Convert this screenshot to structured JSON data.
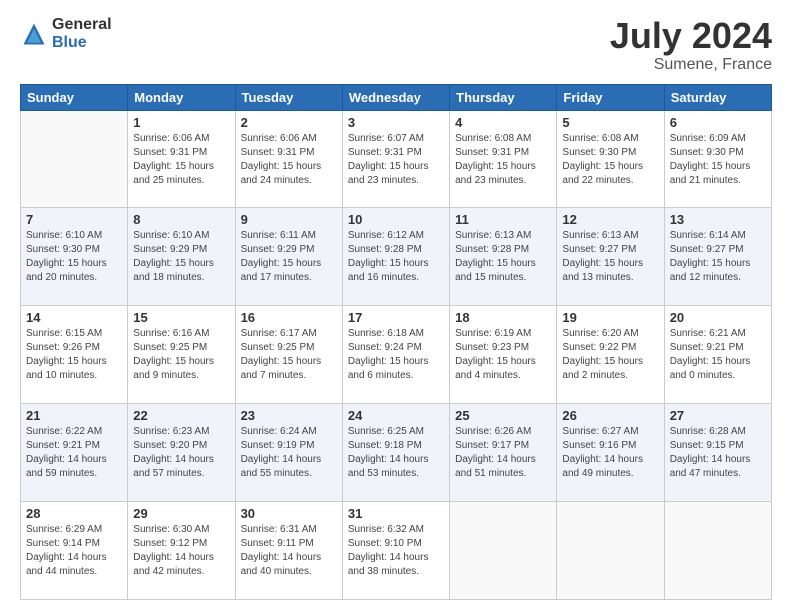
{
  "logo": {
    "general": "General",
    "blue": "Blue"
  },
  "title": "July 2024",
  "subtitle": "Sumene, France",
  "days_of_week": [
    "Sunday",
    "Monday",
    "Tuesday",
    "Wednesday",
    "Thursday",
    "Friday",
    "Saturday"
  ],
  "weeks": [
    [
      {
        "day": "",
        "sunrise": "",
        "sunset": "",
        "daylight": ""
      },
      {
        "day": "1",
        "sunrise": "Sunrise: 6:06 AM",
        "sunset": "Sunset: 9:31 PM",
        "daylight": "Daylight: 15 hours and 25 minutes."
      },
      {
        "day": "2",
        "sunrise": "Sunrise: 6:06 AM",
        "sunset": "Sunset: 9:31 PM",
        "daylight": "Daylight: 15 hours and 24 minutes."
      },
      {
        "day": "3",
        "sunrise": "Sunrise: 6:07 AM",
        "sunset": "Sunset: 9:31 PM",
        "daylight": "Daylight: 15 hours and 23 minutes."
      },
      {
        "day": "4",
        "sunrise": "Sunrise: 6:08 AM",
        "sunset": "Sunset: 9:31 PM",
        "daylight": "Daylight: 15 hours and 23 minutes."
      },
      {
        "day": "5",
        "sunrise": "Sunrise: 6:08 AM",
        "sunset": "Sunset: 9:30 PM",
        "daylight": "Daylight: 15 hours and 22 minutes."
      },
      {
        "day": "6",
        "sunrise": "Sunrise: 6:09 AM",
        "sunset": "Sunset: 9:30 PM",
        "daylight": "Daylight: 15 hours and 21 minutes."
      }
    ],
    [
      {
        "day": "7",
        "sunrise": "Sunrise: 6:10 AM",
        "sunset": "Sunset: 9:30 PM",
        "daylight": "Daylight: 15 hours and 20 minutes."
      },
      {
        "day": "8",
        "sunrise": "Sunrise: 6:10 AM",
        "sunset": "Sunset: 9:29 PM",
        "daylight": "Daylight: 15 hours and 18 minutes."
      },
      {
        "day": "9",
        "sunrise": "Sunrise: 6:11 AM",
        "sunset": "Sunset: 9:29 PM",
        "daylight": "Daylight: 15 hours and 17 minutes."
      },
      {
        "day": "10",
        "sunrise": "Sunrise: 6:12 AM",
        "sunset": "Sunset: 9:28 PM",
        "daylight": "Daylight: 15 hours and 16 minutes."
      },
      {
        "day": "11",
        "sunrise": "Sunrise: 6:13 AM",
        "sunset": "Sunset: 9:28 PM",
        "daylight": "Daylight: 15 hours and 15 minutes."
      },
      {
        "day": "12",
        "sunrise": "Sunrise: 6:13 AM",
        "sunset": "Sunset: 9:27 PM",
        "daylight": "Daylight: 15 hours and 13 minutes."
      },
      {
        "day": "13",
        "sunrise": "Sunrise: 6:14 AM",
        "sunset": "Sunset: 9:27 PM",
        "daylight": "Daylight: 15 hours and 12 minutes."
      }
    ],
    [
      {
        "day": "14",
        "sunrise": "Sunrise: 6:15 AM",
        "sunset": "Sunset: 9:26 PM",
        "daylight": "Daylight: 15 hours and 10 minutes."
      },
      {
        "day": "15",
        "sunrise": "Sunrise: 6:16 AM",
        "sunset": "Sunset: 9:25 PM",
        "daylight": "Daylight: 15 hours and 9 minutes."
      },
      {
        "day": "16",
        "sunrise": "Sunrise: 6:17 AM",
        "sunset": "Sunset: 9:25 PM",
        "daylight": "Daylight: 15 hours and 7 minutes."
      },
      {
        "day": "17",
        "sunrise": "Sunrise: 6:18 AM",
        "sunset": "Sunset: 9:24 PM",
        "daylight": "Daylight: 15 hours and 6 minutes."
      },
      {
        "day": "18",
        "sunrise": "Sunrise: 6:19 AM",
        "sunset": "Sunset: 9:23 PM",
        "daylight": "Daylight: 15 hours and 4 minutes."
      },
      {
        "day": "19",
        "sunrise": "Sunrise: 6:20 AM",
        "sunset": "Sunset: 9:22 PM",
        "daylight": "Daylight: 15 hours and 2 minutes."
      },
      {
        "day": "20",
        "sunrise": "Sunrise: 6:21 AM",
        "sunset": "Sunset: 9:21 PM",
        "daylight": "Daylight: 15 hours and 0 minutes."
      }
    ],
    [
      {
        "day": "21",
        "sunrise": "Sunrise: 6:22 AM",
        "sunset": "Sunset: 9:21 PM",
        "daylight": "Daylight: 14 hours and 59 minutes."
      },
      {
        "day": "22",
        "sunrise": "Sunrise: 6:23 AM",
        "sunset": "Sunset: 9:20 PM",
        "daylight": "Daylight: 14 hours and 57 minutes."
      },
      {
        "day": "23",
        "sunrise": "Sunrise: 6:24 AM",
        "sunset": "Sunset: 9:19 PM",
        "daylight": "Daylight: 14 hours and 55 minutes."
      },
      {
        "day": "24",
        "sunrise": "Sunrise: 6:25 AM",
        "sunset": "Sunset: 9:18 PM",
        "daylight": "Daylight: 14 hours and 53 minutes."
      },
      {
        "day": "25",
        "sunrise": "Sunrise: 6:26 AM",
        "sunset": "Sunset: 9:17 PM",
        "daylight": "Daylight: 14 hours and 51 minutes."
      },
      {
        "day": "26",
        "sunrise": "Sunrise: 6:27 AM",
        "sunset": "Sunset: 9:16 PM",
        "daylight": "Daylight: 14 hours and 49 minutes."
      },
      {
        "day": "27",
        "sunrise": "Sunrise: 6:28 AM",
        "sunset": "Sunset: 9:15 PM",
        "daylight": "Daylight: 14 hours and 47 minutes."
      }
    ],
    [
      {
        "day": "28",
        "sunrise": "Sunrise: 6:29 AM",
        "sunset": "Sunset: 9:14 PM",
        "daylight": "Daylight: 14 hours and 44 minutes."
      },
      {
        "day": "29",
        "sunrise": "Sunrise: 6:30 AM",
        "sunset": "Sunset: 9:12 PM",
        "daylight": "Daylight: 14 hours and 42 minutes."
      },
      {
        "day": "30",
        "sunrise": "Sunrise: 6:31 AM",
        "sunset": "Sunset: 9:11 PM",
        "daylight": "Daylight: 14 hours and 40 minutes."
      },
      {
        "day": "31",
        "sunrise": "Sunrise: 6:32 AM",
        "sunset": "Sunset: 9:10 PM",
        "daylight": "Daylight: 14 hours and 38 minutes."
      },
      {
        "day": "",
        "sunrise": "",
        "sunset": "",
        "daylight": ""
      },
      {
        "day": "",
        "sunrise": "",
        "sunset": "",
        "daylight": ""
      },
      {
        "day": "",
        "sunrise": "",
        "sunset": "",
        "daylight": ""
      }
    ]
  ]
}
